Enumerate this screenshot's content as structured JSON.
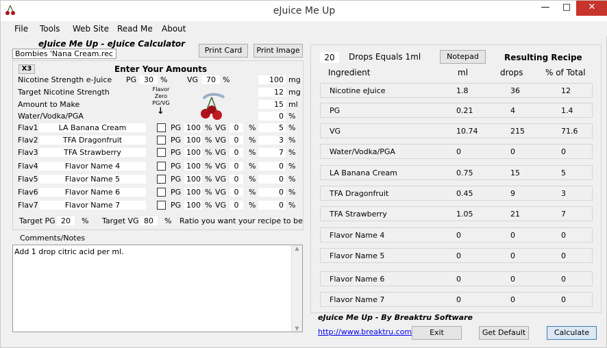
{
  "window": {
    "title": "eJuice Me Up",
    "minimize": "—",
    "maximize": "□",
    "close": "✕",
    "app_icon": "cherry-icon"
  },
  "menu": [
    "File",
    "Tools",
    "Web Site",
    "Read Me",
    "About"
  ],
  "left": {
    "heading": "eJuice Me Up - eJuice Calculator",
    "file_name": "Bombies 'Nana Cream.rec",
    "print_card": "Print Card",
    "print_image": "Print Image",
    "x3": "X3",
    "enter_amounts": "Enter Your Amounts",
    "nic_label": "Nicotine Strength e-Juice",
    "pg_label": "PG",
    "pg_value": "30",
    "pct": "%",
    "vg_label": "VG",
    "vg_value": "70",
    "nic_value": "100",
    "mg": "mg",
    "ml": "ml",
    "target_nic_label": "Target Nicotine Strength",
    "target_nic_value": "12",
    "amount_label": "Amount to Make",
    "amount_value": "15",
    "water_label": "Water/Vodka/PGA",
    "water_value": "0",
    "flavor_zero": "Flavor Zero PG/VG",
    "arrow": "↓",
    "flavors": [
      {
        "slot": "Flav1",
        "name": "LA Banana Cream",
        "pg": "100",
        "vg": "0",
        "pct": "5"
      },
      {
        "slot": "Flav2",
        "name": "TFA Dragonfruit",
        "pg": "100",
        "vg": "0",
        "pct": "3"
      },
      {
        "slot": "Flav3",
        "name": "TFA Strawberry",
        "pg": "100",
        "vg": "0",
        "pct": "7"
      },
      {
        "slot": "Flav4",
        "name": "Flavor Name 4",
        "pg": "100",
        "vg": "0",
        "pct": "0"
      },
      {
        "slot": "Flav5",
        "name": "Flavor Name 5",
        "pg": "100",
        "vg": "0",
        "pct": "0"
      },
      {
        "slot": "Flav6",
        "name": "Flavor Name 6",
        "pg": "100",
        "vg": "0",
        "pct": "0"
      },
      {
        "slot": "Flav7",
        "name": "Flavor Name 7",
        "pg": "100",
        "vg": "0",
        "pct": "0"
      }
    ],
    "flav_pg": "PG",
    "flav_vg": "VG",
    "target_pg_label": "Target PG",
    "target_pg_value": "20",
    "target_vg_label": "Target VG",
    "target_vg_value": "80",
    "ratio_note": "Ratio you want your recipe to be",
    "comments_label": "Comments/Notes",
    "comments_text": "Add 1 drop citric acid per ml."
  },
  "right": {
    "drops_value": "20",
    "drops_label": "Drops Equals 1ml",
    "notepad": "Notepad",
    "resulting": "Resulting Recipe",
    "headers": [
      "Ingredient",
      "ml",
      "drops",
      "% of Total"
    ],
    "rows": [
      {
        "name": "Nicotine eJuice",
        "ml": "1.8",
        "drops": "36",
        "pct": "12"
      },
      {
        "name": "PG",
        "ml": "0.21",
        "drops": "4",
        "pct": "1.4"
      },
      {
        "name": "VG",
        "ml": "10.74",
        "drops": "215",
        "pct": "71.6"
      },
      {
        "name": "Water/Vodka/PGA",
        "ml": "0",
        "drops": "0",
        "pct": "0"
      },
      {
        "name": "LA Banana Cream",
        "ml": "0.75",
        "drops": "15",
        "pct": "5"
      },
      {
        "name": "TFA Dragonfruit",
        "ml": "0.45",
        "drops": "9",
        "pct": "3"
      },
      {
        "name": "TFA Strawberry",
        "ml": "1.05",
        "drops": "21",
        "pct": "7"
      },
      {
        "name": "Flavor Name 4",
        "ml": "0",
        "drops": "0",
        "pct": "0"
      },
      {
        "name": "Flavor Name 5",
        "ml": "0",
        "drops": "0",
        "pct": "0"
      },
      {
        "name": "Flavor Name 6",
        "ml": "0",
        "drops": "0",
        "pct": "0"
      },
      {
        "name": "Flavor Name 7",
        "ml": "0",
        "drops": "0",
        "pct": "0"
      }
    ],
    "footer": "eJuice Me Up - By Breaktru Software"
  },
  "bottom": {
    "link": "http://www.breaktru.com",
    "exit": "Exit",
    "get_default": "Get Default",
    "calculate": "Calculate"
  },
  "colors": {
    "close_red": "#c7342c",
    "link_blue": "#0000ee",
    "calc_border": "#3c7fb1",
    "calc_bg": "#dbe8f5"
  }
}
